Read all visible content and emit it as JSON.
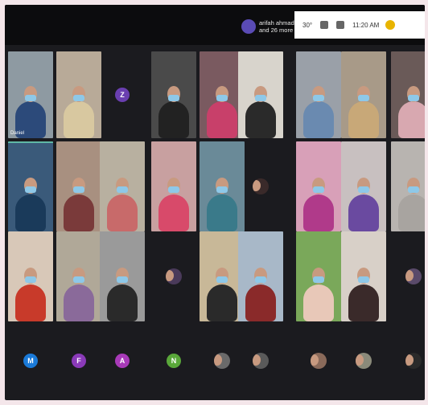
{
  "presenter": {
    "line1": "arifah ahmad",
    "line2": "and 26 more"
  },
  "taskbar": {
    "temp": "30°",
    "time": "11:20 AM"
  },
  "participants": {
    "row1": [
      {
        "kind": "video",
        "bg": "#8e9aa2",
        "shirt": "#2c4a7a",
        "name": "Daniel"
      },
      {
        "kind": "video",
        "bg": "#b8aa98",
        "shirt": "#d8c8a0"
      },
      {
        "kind": "initial",
        "letter": "Z",
        "color": "#6a3fb0"
      },
      {
        "kind": "video",
        "bg": "#4a4a4a",
        "shirt": "#222222"
      },
      {
        "kind": "video",
        "bg": "#7a5a60",
        "shirt": "#c8406a"
      },
      {
        "kind": "video",
        "bg": "#d8d4cc",
        "shirt": "#2a2a2a"
      },
      {
        "kind": "video",
        "bg": "#9aa0a8",
        "shirt": "#6a8ab0"
      },
      {
        "kind": "video",
        "bg": "#a89a88",
        "shirt": "#c8a878"
      },
      {
        "kind": "video",
        "bg": "#6a5a58",
        "shirt": "#d8a8b0"
      }
    ],
    "row2": [
      {
        "kind": "video",
        "bg": "#3a5a7a",
        "shirt": "#1a3a5a",
        "active": true
      },
      {
        "kind": "video",
        "bg": "#a89080",
        "shirt": "#7a3a3a"
      },
      {
        "kind": "video",
        "bg": "#b8b0a0",
        "shirt": "#c86a6a"
      },
      {
        "kind": "video",
        "bg": "#c8a0a0",
        "shirt": "#d84a6a"
      },
      {
        "kind": "video",
        "bg": "#6a8a98",
        "shirt": "#3a7a8a"
      },
      {
        "kind": "photo",
        "bg": "#3a2a2a"
      },
      {
        "kind": "video",
        "bg": "#d8a0b8",
        "shirt": "#b03a8a"
      },
      {
        "kind": "video",
        "bg": "#c8c0c0",
        "shirt": "#6a4aa0"
      },
      {
        "kind": "video",
        "bg": "#b8b4b0",
        "shirt": "#a8a4a0"
      }
    ],
    "row3": [
      {
        "kind": "video",
        "bg": "#d8c8b8",
        "shirt": "#c83a2a"
      },
      {
        "kind": "video",
        "bg": "#b0a898",
        "shirt": "#8a6a9a"
      },
      {
        "kind": "video",
        "bg": "#9a9a9a",
        "shirt": "#2a2a2a"
      },
      {
        "kind": "photo",
        "bg": "#4a3a5a"
      },
      {
        "kind": "video",
        "bg": "#c8b898",
        "shirt": "#2a2a2a"
      },
      {
        "kind": "video",
        "bg": "#a8b8c8",
        "shirt": "#8a2a2a"
      },
      {
        "kind": "video",
        "bg": "#7aa85a",
        "shirt": "#e8c8b8"
      },
      {
        "kind": "video",
        "bg": "#d8d0c8",
        "shirt": "#3a2a2a"
      },
      {
        "kind": "photo",
        "bg": "#5a4a6a"
      }
    ],
    "row4": [
      {
        "kind": "initial",
        "letter": "M",
        "color": "#1a7ad8"
      },
      {
        "kind": "initial",
        "letter": "F",
        "color": "#8a3ab8"
      },
      {
        "kind": "initial",
        "letter": "A",
        "color": "#a83ab8"
      },
      {
        "kind": "initial",
        "letter": "N",
        "color": "#5aa83a"
      },
      {
        "kind": "photo",
        "bg": "#6a6a6a"
      },
      {
        "kind": "photo",
        "bg": "#5a5a5a"
      },
      {
        "kind": "photo",
        "bg": "#8a6a5a"
      },
      {
        "kind": "photo",
        "bg": "#8a8a7a"
      },
      {
        "kind": "photo",
        "bg": "#2a2a2a"
      }
    ]
  }
}
